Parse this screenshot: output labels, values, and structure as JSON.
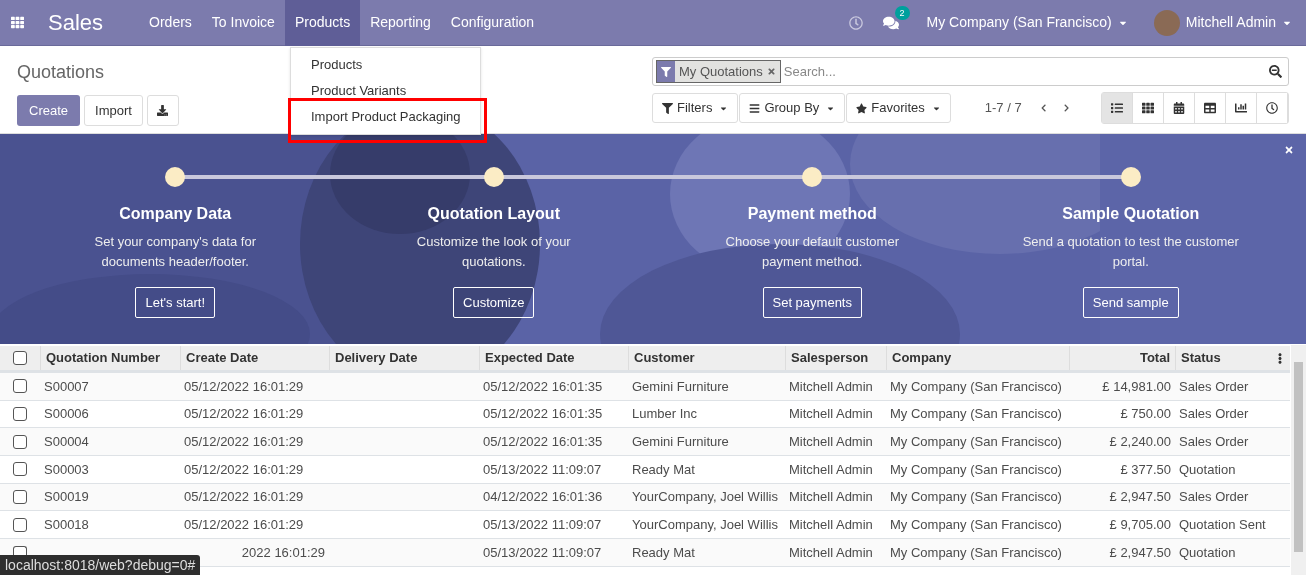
{
  "navbar": {
    "app_name": "Sales",
    "menu": [
      {
        "label": "Orders",
        "selected": false
      },
      {
        "label": "To Invoice",
        "selected": false
      },
      {
        "label": "Products",
        "selected": true
      },
      {
        "label": "Reporting",
        "selected": false
      },
      {
        "label": "Configuration",
        "selected": false
      }
    ],
    "messages_badge": "2",
    "company": "My Company (San Francisco)",
    "user": "Mitchell Admin"
  },
  "dropdown": {
    "items": [
      {
        "label": "Products",
        "highlighted": false
      },
      {
        "label": "Product Variants",
        "highlighted": false
      },
      {
        "label": "Import Product Packaging",
        "highlighted": true
      }
    ]
  },
  "breadcrumb": "Quotations",
  "buttons": {
    "create": "Create",
    "import": "Import"
  },
  "search": {
    "facet": "My Quotations",
    "placeholder": "Search..."
  },
  "search_buttons": [
    "Filters",
    "Group By",
    "Favorites"
  ],
  "pager": "1-7 / 7",
  "views": [
    {
      "kind": "list",
      "selected": true
    },
    {
      "kind": "kanban",
      "selected": false
    },
    {
      "kind": "calendar",
      "selected": false
    },
    {
      "kind": "pivot",
      "selected": false
    },
    {
      "kind": "graph",
      "selected": false
    },
    {
      "kind": "activity",
      "selected": false
    }
  ],
  "onboarding": {
    "steps": [
      {
        "title": "Company Data",
        "description": "Set your company's data for documents header/footer.",
        "button": "Let's start!"
      },
      {
        "title": "Quotation Layout",
        "description": "Customize the look of your quotations.",
        "button": "Customize"
      },
      {
        "title": "Payment method",
        "description": "Choose your default customer payment method.",
        "button": "Set payments"
      },
      {
        "title": "Sample Quotation",
        "description": "Send a quotation to test the customer portal.",
        "button": "Send sample"
      }
    ]
  },
  "table": {
    "all_checked": false,
    "columns": [
      "Quotation Number",
      "Create Date",
      "Delivery Date",
      "Expected Date",
      "Customer",
      "Salesperson",
      "Company",
      "Total",
      "Status"
    ],
    "rows": [
      {
        "number": "S00007",
        "create_date": "05/12/2022 16:01:29",
        "expected_date": "05/12/2022 16:01:35",
        "customer": "Gemini Furniture",
        "salesperson": "Mitchell Admin",
        "company": "My Company (San Francisco)",
        "total": "£ 14,981.00",
        "status": "Sales Order"
      },
      {
        "number": "S00006",
        "create_date": "05/12/2022 16:01:29",
        "expected_date": "05/12/2022 16:01:35",
        "customer": "Lumber Inc",
        "salesperson": "Mitchell Admin",
        "company": "My Company (San Francisco)",
        "total": "£ 750.00",
        "status": "Sales Order"
      },
      {
        "number": "S00004",
        "create_date": "05/12/2022 16:01:29",
        "expected_date": "05/12/2022 16:01:35",
        "customer": "Gemini Furniture",
        "salesperson": "Mitchell Admin",
        "company": "My Company (San Francisco)",
        "total": "£ 2,240.00",
        "status": "Sales Order"
      },
      {
        "number": "S00003",
        "create_date": "05/12/2022 16:01:29",
        "expected_date": "05/13/2022 11:09:07",
        "customer": "Ready Mat",
        "salesperson": "Mitchell Admin",
        "company": "My Company (San Francisco)",
        "total": "£ 377.50",
        "status": "Quotation"
      },
      {
        "number": "S00019",
        "create_date": "05/12/2022 16:01:29",
        "expected_date": "04/12/2022 16:01:36",
        "customer": "YourCompany, Joel Willis",
        "salesperson": "Mitchell Admin",
        "company": "My Company (San Francisco)",
        "total": "£ 2,947.50",
        "status": "Sales Order"
      },
      {
        "number": "S00018",
        "create_date": "05/12/2022 16:01:29",
        "expected_date": "05/13/2022 11:09:07",
        "customer": "YourCompany, Joel Willis",
        "salesperson": "Mitchell Admin",
        "company": "My Company (San Francisco)",
        "total": "£ 9,705.00",
        "status": "Quotation Sent"
      },
      {
        "create_date": "2022 16:01:29",
        "expected_date": "05/13/2022 11:09:07",
        "customer": "Ready Mat",
        "salesperson": "Mitchell Admin",
        "company": "My Company (San Francisco)",
        "total": "£ 2,947.50",
        "status": "Quotation"
      }
    ]
  },
  "row_checks": [
    false,
    false,
    false,
    false,
    false,
    false,
    false
  ],
  "status_bar": "localhost:8018/web?debug=0#"
}
